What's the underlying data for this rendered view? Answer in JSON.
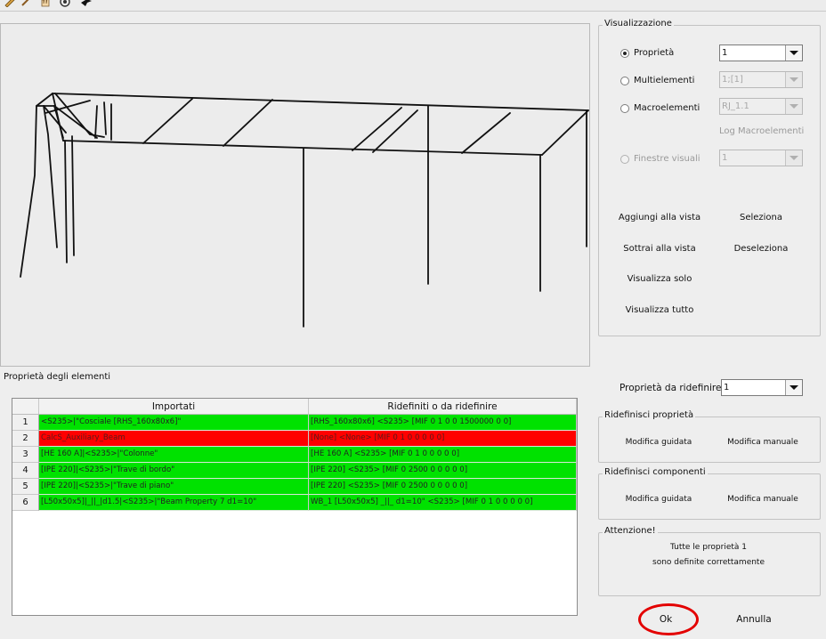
{
  "toolbar": {
    "icons": [
      "pencil-icon",
      "hand-icon",
      "orbit-icon",
      "bird-icon"
    ]
  },
  "visualization": {
    "title": "Visualizzazione",
    "options": [
      {
        "label": "Proprietà",
        "selected": true,
        "enabled": true,
        "combo_value": "1",
        "combo_enabled": true
      },
      {
        "label": "Multielementi",
        "selected": false,
        "enabled": true,
        "combo_value": "1;[1]",
        "combo_enabled": false
      },
      {
        "label": "Macroelementi",
        "selected": false,
        "enabled": true,
        "combo_value": "RJ_1.1",
        "combo_enabled": false
      },
      {
        "label": "Finestre visuali",
        "selected": false,
        "enabled": false,
        "combo_value": "1",
        "combo_enabled": false
      }
    ],
    "log_macro": "Log Macroelementi",
    "buttons": {
      "add": "Aggiungi alla vista",
      "select": "Seleziona",
      "subtract": "Sottrai alla vista",
      "deselect": "Deseleziona",
      "show_only": "Visualizza solo",
      "show_all": "Visualizza tutto"
    }
  },
  "properties": {
    "title": "Proprietà degli elementi",
    "columns": [
      "Importati",
      "Ridefiniti o da ridefinire"
    ],
    "rows": [
      {
        "n": "1",
        "imported": "<S235>|\"Cosciale   [RHS_160x80x6]\"",
        "redefined": "[RHS_160x80x6]  <S235>  [MIF 0 1 0 0 1500000 0 0]",
        "status": "ok"
      },
      {
        "n": "2",
        "imported": "CalcS_Auxiliary_Beam",
        "redefined": "[None]  <None>  [MIF 0 1 0 0 0 0 0]",
        "status": "error"
      },
      {
        "n": "3",
        "imported": "[HE 160 A]|<S235>|\"Colonne\"",
        "redefined": "[HE 160 A]  <S235>  [MIF 0 1 0 0 0 0 0]",
        "status": "ok"
      },
      {
        "n": "4",
        "imported": "[IPE 220]|<S235>|\"Trave di bordo\"",
        "redefined": "[IPE 220]  <S235>  [MIF 0 2500 0 0 0 0 0]",
        "status": "ok"
      },
      {
        "n": "5",
        "imported": "[IPE 220]|<S235>|\"Trave di piano\"",
        "redefined": "[IPE 220]  <S235>  [MIF 0 2500 0 0 0 0 0]",
        "status": "ok"
      },
      {
        "n": "6",
        "imported": "[L50x50x5]|_||_|d1.5|<S235>|\"Beam Property 7   d1=10\"",
        "redefined": "WB_1   [L50x50x5]  _||_  d1=10\"  <S235>  [MIF 0 1 0 0 0 0 0]",
        "status": "ok"
      }
    ],
    "colors": {
      "ok": "#00e200",
      "error": "#ff0000",
      "ok_text": "#222222",
      "error_text": "#5a1a1a"
    }
  },
  "redefine": {
    "label": "Proprietà da ridefinire",
    "combo_value": "1",
    "props_group": "Ridefinisci proprietà",
    "props_guided": "Modifica guidata",
    "props_manual": "Modifica manuale",
    "comp_group": "Ridefinisci componenti",
    "comp_guided": "Modifica guidata",
    "comp_manual": "Modifica manuale"
  },
  "attention": {
    "title": "Attenzione!",
    "line1": "Tutte le proprietà 1",
    "line2": "sono definite correttamente"
  },
  "dialog": {
    "ok": "Ok",
    "cancel": "Annulla",
    "highlight_color": "#e30000"
  }
}
